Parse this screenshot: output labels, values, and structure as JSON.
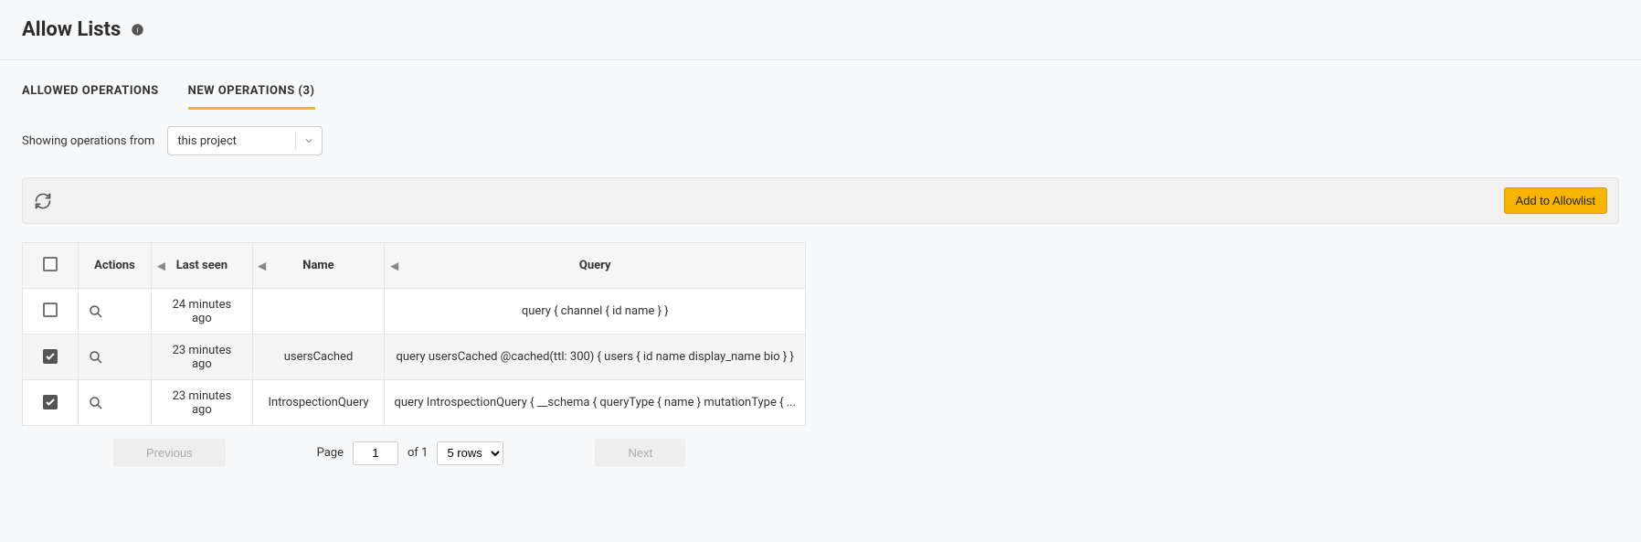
{
  "header": {
    "title": "Allow Lists"
  },
  "tabs": {
    "allowed": "ALLOWED OPERATIONS",
    "newops": "NEW OPERATIONS (3)"
  },
  "filter": {
    "label": "Showing operations from",
    "selected": "this project"
  },
  "toolbar": {
    "add_button": "Add to Allowlist"
  },
  "table": {
    "headers": {
      "actions": "Actions",
      "last_seen": "Last seen",
      "name": "Name",
      "query": "Query"
    },
    "rows": [
      {
        "checked": false,
        "last_seen": "24 minutes ago",
        "name": "",
        "query": "query { channel { id name } }"
      },
      {
        "checked": true,
        "last_seen": "23 minutes ago",
        "name": "usersCached",
        "query": "query usersCached @cached(ttl: 300) { users { id name display_name bio } }"
      },
      {
        "checked": true,
        "last_seen": "23 minutes ago",
        "name": "IntrospectionQuery",
        "query": "query IntrospectionQuery { __schema { queryType { name } mutationType { ..."
      }
    ]
  },
  "pagination": {
    "previous": "Previous",
    "next": "Next",
    "page_label": "Page",
    "page_value": "1",
    "of_label": "of 1",
    "rows_label": "5 rows"
  }
}
